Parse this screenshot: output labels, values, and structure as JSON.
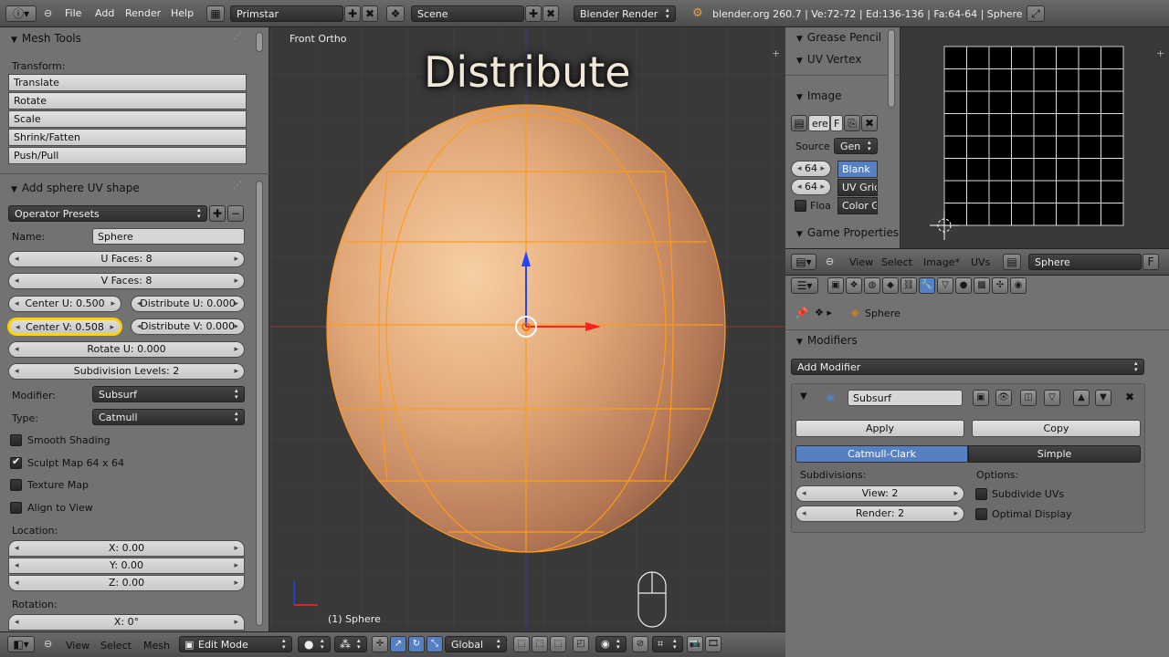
{
  "topbar": {
    "menus": [
      "File",
      "Add",
      "Render",
      "Help"
    ],
    "screen_layout": "Primstar",
    "scene": "Scene",
    "render_engine": "Blender Render",
    "stats": "blender.org 260.7 | Ve:72-72 | Ed:136-136 | Fa:64-64 | Sphere"
  },
  "mesh_tools": {
    "title": "Mesh Tools",
    "transform_label": "Transform:",
    "buttons": [
      "Translate",
      "Rotate",
      "Scale",
      "Shrink/Fatten",
      "Push/Pull"
    ]
  },
  "operator": {
    "title": "Add sphere UV shape",
    "presets": "Operator Presets",
    "name_label": "Name:",
    "name_value": "Sphere",
    "u_faces": "U Faces: 8",
    "v_faces": "V Faces: 8",
    "center_u": "Center U: 0.500",
    "distribute_u": "Distribute U: 0.000",
    "center_v": "Center V: 0.508",
    "distribute_v": "Distribute V: 0.000",
    "rotate_u": "Rotate U: 0.000",
    "subdivision_levels": "Subdivision Levels: 2",
    "modifier_label": "Modifier:",
    "modifier_value": "Subsurf",
    "type_label": "Type:",
    "type_value": "Catmull",
    "smooth_shading": "Smooth Shading",
    "sculpt_map": "Sculpt Map 64 x 64",
    "texture_map": "Texture Map",
    "align_to_view": "Align to View",
    "location_label": "Location:",
    "loc_x": "X: 0.00",
    "loc_y": "Y: 0.00",
    "loc_z": "Z: 0.00",
    "rotation_label": "Rotation:",
    "rot_x": "X: 0°"
  },
  "viewport": {
    "view_name": "Front Ortho",
    "overlay_title": "Distribute",
    "object_label": "(1) Sphere"
  },
  "uv_tools": {
    "grease_pencil": "Grease Pencil",
    "uv_vertex": "UV Vertex",
    "image": "Image",
    "image_name": "ere",
    "image_f": "F",
    "source_label": "Source",
    "source_value": "Gen",
    "width": "64",
    "height": "64",
    "blank": "Blank",
    "uv_grid": "UV Grid",
    "color_grid": "Color G",
    "float_label": "Floa",
    "game_properties": "Game Properties"
  },
  "image_editor_header": {
    "menus": [
      "View",
      "Select",
      "Image*",
      "UVs"
    ],
    "image_name": "Sphere",
    "f": "F"
  },
  "properties": {
    "breadcrumb_object": "Sphere",
    "modifiers_title": "Modifiers",
    "add_modifier": "Add Modifier",
    "modifier_name": "Subsurf",
    "apply": "Apply",
    "copy": "Copy",
    "catmull_clark": "Catmull-Clark",
    "simple": "Simple",
    "subdivisions_label": "Subdivisions:",
    "view": "View: 2",
    "render": "Render: 2",
    "options_label": "Options:",
    "subdivide_uvs": "Subdivide UVs",
    "optimal_display": "Optimal Display"
  },
  "bottombar": {
    "menus": [
      "View",
      "Select",
      "Mesh"
    ],
    "mode": "Edit Mode",
    "orientation": "Global"
  },
  "colors": {
    "accent_blue": "#5680c2",
    "highlight_yellow": "#ffd400",
    "edge_orange": "#ff9a1a",
    "sphere_base": "#e0a87a"
  }
}
